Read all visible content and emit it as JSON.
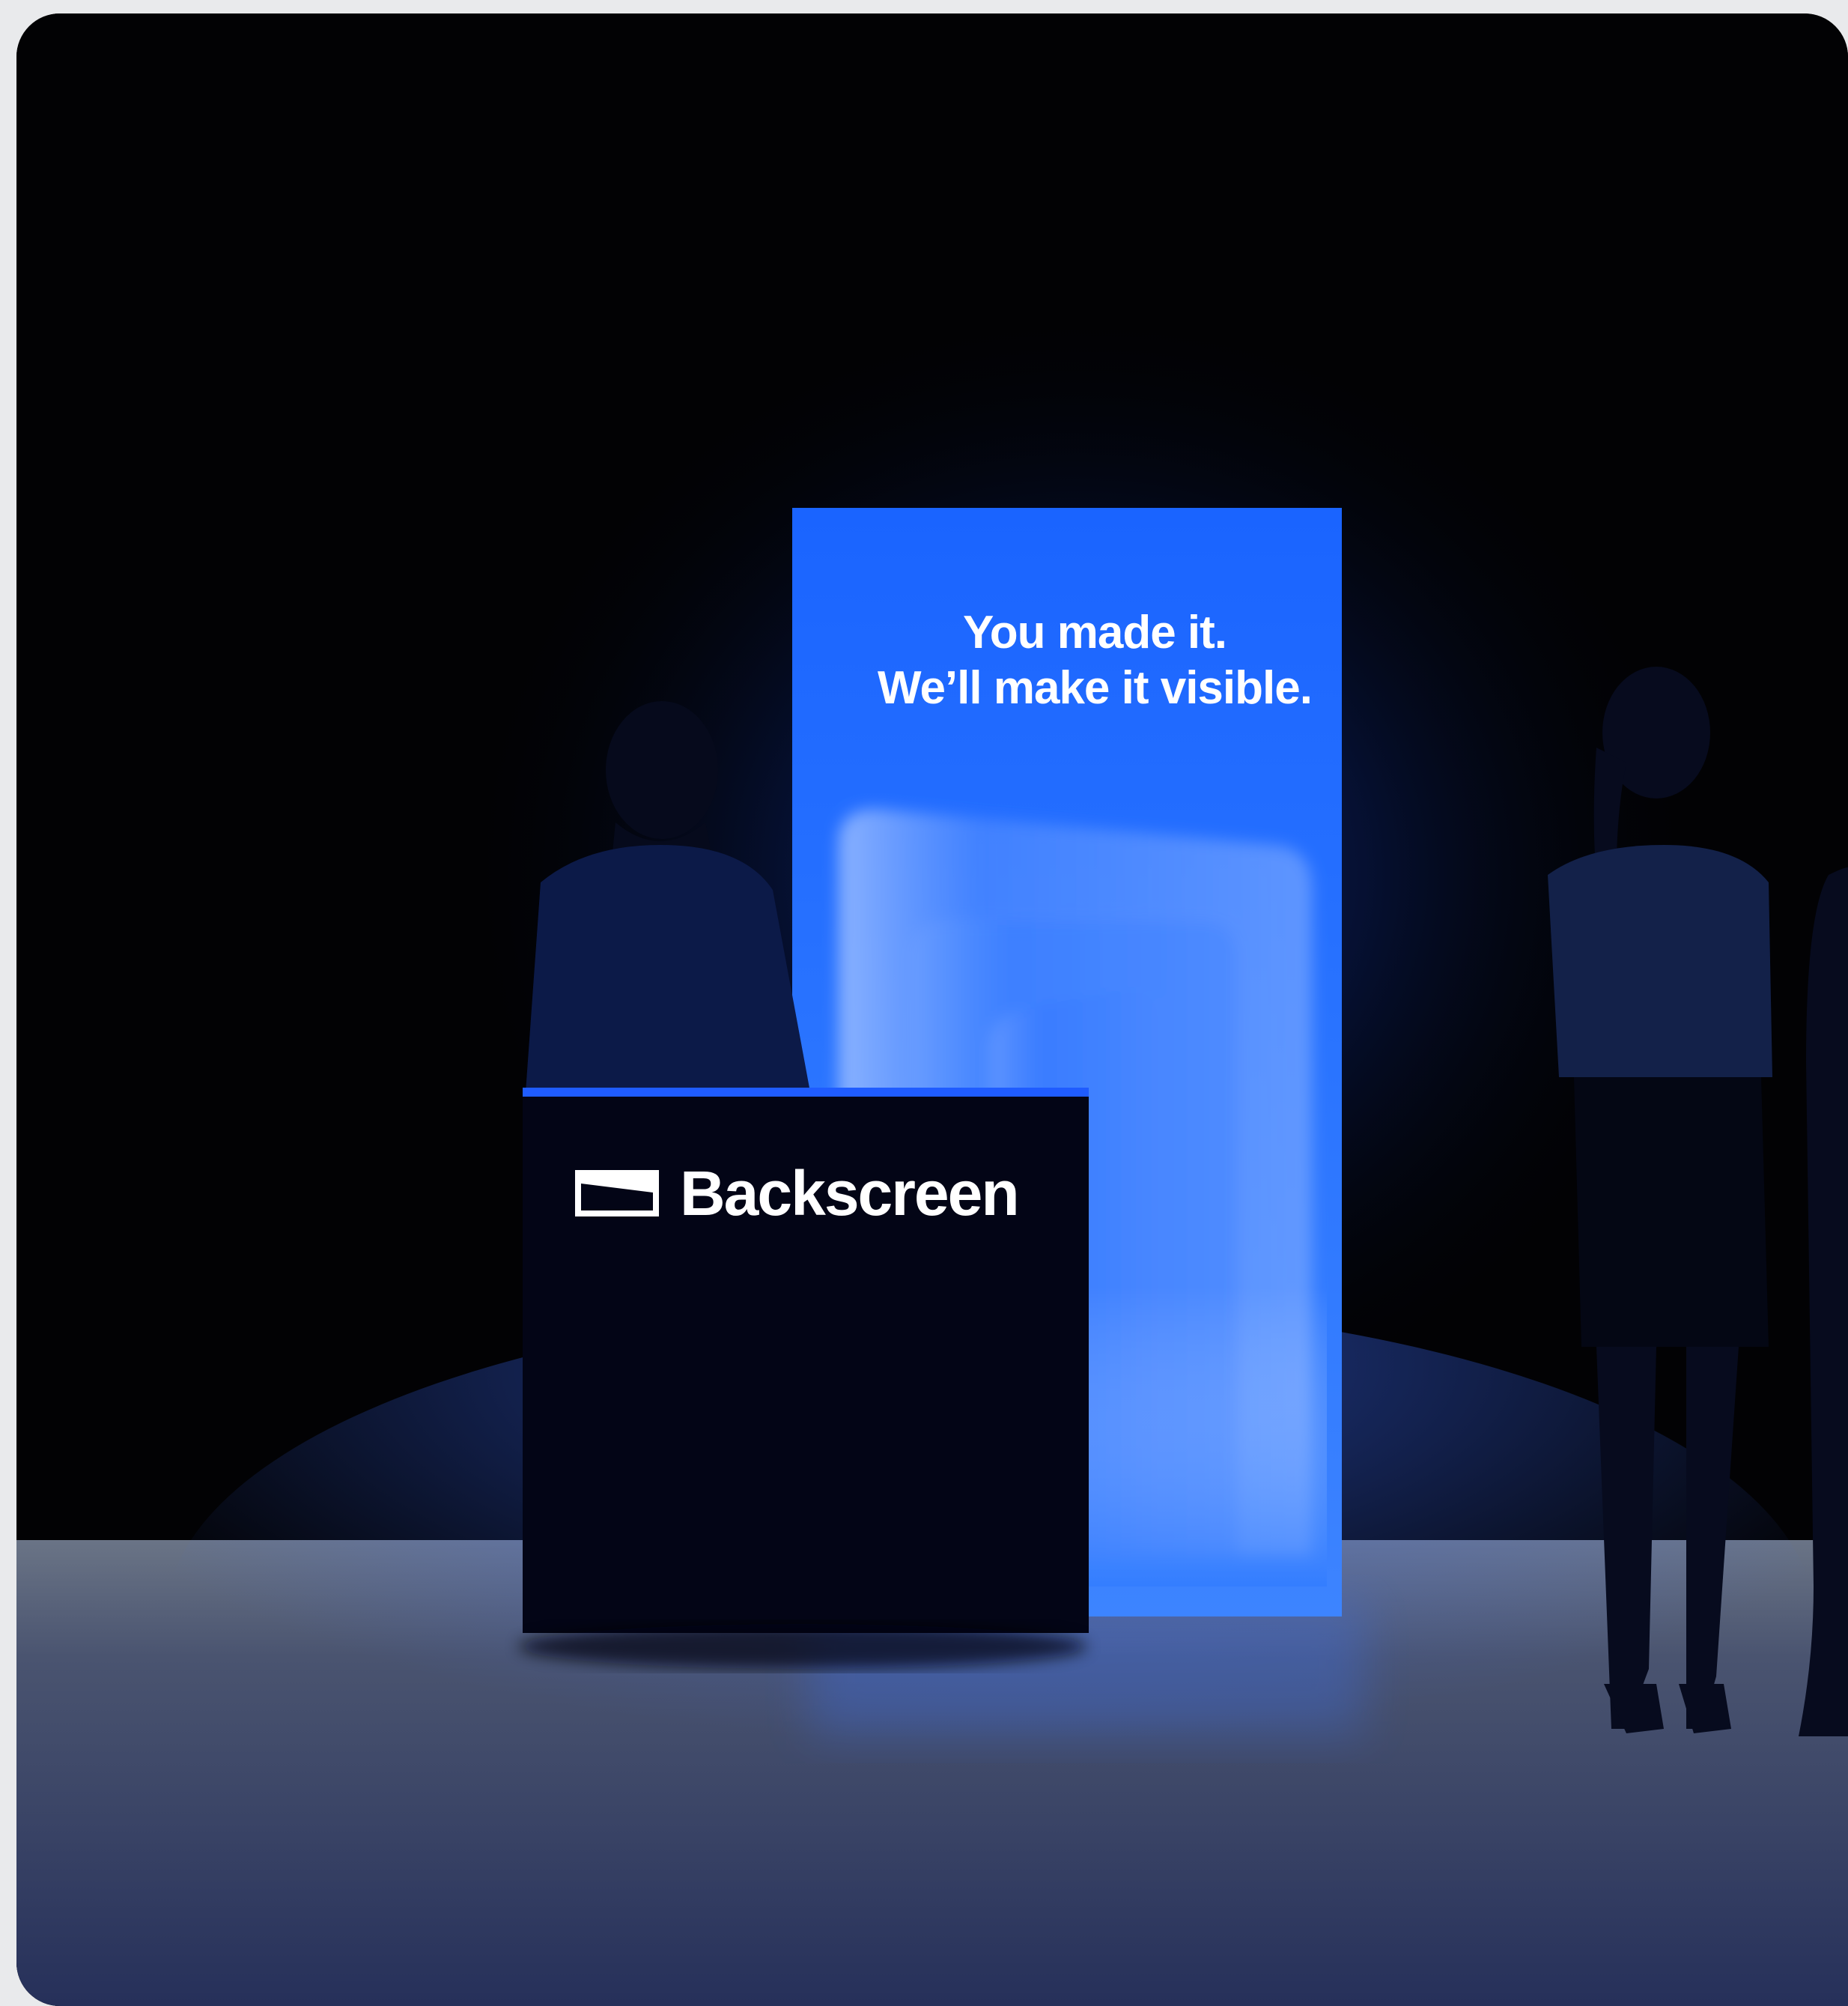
{
  "panel": {
    "headline_line1": "You made it.",
    "headline_line2": "We’ll make it visible."
  },
  "counter": {
    "brand_name": "Backscreen",
    "logo_icon": "screen-icon"
  },
  "colors": {
    "panel_blue": "#1f6bff",
    "background": "#000000",
    "floor": "#5d6b82",
    "page": "#e9eaec"
  }
}
